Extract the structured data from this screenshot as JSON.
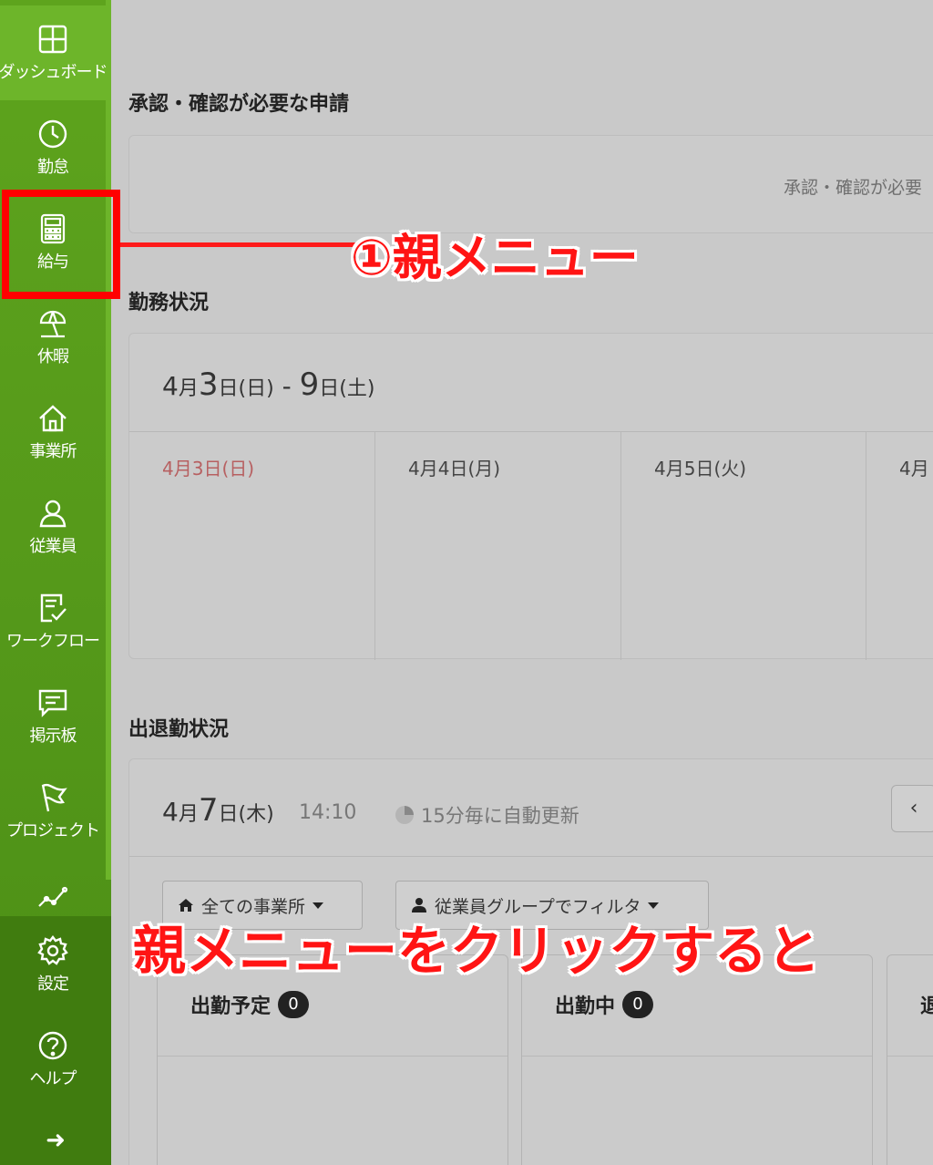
{
  "sidebar": {
    "items": [
      {
        "label": "ダッシュボード",
        "icon": "dashboard-icon"
      },
      {
        "label": "勤怠",
        "icon": "clock-icon"
      },
      {
        "label": "給与",
        "icon": "calculator-icon"
      },
      {
        "label": "休暇",
        "icon": "beach-umbrella-icon"
      },
      {
        "label": "事業所",
        "icon": "home-icon"
      },
      {
        "label": "従業員",
        "icon": "person-icon"
      },
      {
        "label": "ワークフロー",
        "icon": "checklist-icon"
      },
      {
        "label": "掲示板",
        "icon": "message-icon"
      },
      {
        "label": "プロジェクト",
        "icon": "flag-icon"
      },
      {
        "label": "",
        "icon": "chart-line-icon"
      }
    ],
    "bottom": [
      {
        "label": "設定",
        "icon": "gear-icon"
      },
      {
        "label": "ヘルプ",
        "icon": "help-icon"
      }
    ],
    "expand_glyph": "➜",
    "active_color": "#6db52a"
  },
  "approvals": {
    "title": "承認・確認が必要な申請",
    "empty_text": "承認・確認が必要"
  },
  "work_status": {
    "title": "勤務状況",
    "range": {
      "m1": "4",
      "mon": "月",
      "d1": "3",
      "day": "日",
      "w1": "(日)",
      "sep": " - ",
      "d2": "9",
      "w2": "(土)"
    },
    "days": [
      "4月3日(日)",
      "4月4日(月)",
      "4月5日(火)",
      "4月"
    ]
  },
  "attendance": {
    "title": "出退勤状況",
    "date": {
      "m": "4",
      "mon": "月",
      "d": "7",
      "day": "日",
      "w": "(木)"
    },
    "time": "14:10",
    "refresh": "15分毎に自動更新",
    "prev_button": "‹",
    "filters": {
      "office": "全ての事業所",
      "group": "従業員グループでフィルタ"
    },
    "stats": [
      {
        "label": "出勤予定",
        "count": "0"
      },
      {
        "label": "出勤中",
        "count": "0"
      },
      {
        "label": "退",
        "count": ""
      }
    ]
  },
  "annotations": {
    "step1": "①親メニュー",
    "step1_note": "親メニューをクリックすると",
    "color": "#ff1414"
  }
}
